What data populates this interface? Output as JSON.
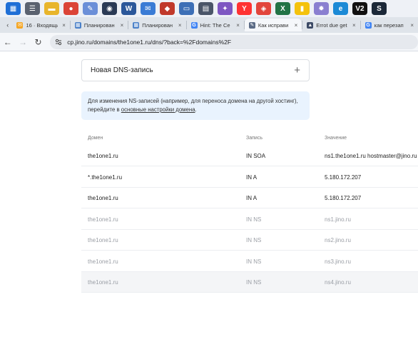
{
  "taskbar": {
    "icons": [
      {
        "name": "windows-widget-icon",
        "color": "#1f6fd6",
        "glyph": "▦"
      },
      {
        "name": "sliders-icon",
        "color": "#5a6270",
        "glyph": "☰"
      },
      {
        "name": "file-explorer-icon",
        "color": "#e8b52c",
        "glyph": "▬"
      },
      {
        "name": "chrome-icon",
        "color": "#db4437",
        "glyph": "●"
      },
      {
        "name": "paint-icon",
        "color": "#6b8fd8",
        "glyph": "✎"
      },
      {
        "name": "steam-like-icon",
        "color": "#2a3a55",
        "glyph": "◉"
      },
      {
        "name": "word-icon",
        "color": "#2b579a",
        "glyph": "W"
      },
      {
        "name": "mail-icon",
        "color": "#3a7bd5",
        "glyph": "✉"
      },
      {
        "name": "game-icon",
        "color": "#c0392b",
        "glyph": "◆"
      },
      {
        "name": "monitor-icon",
        "color": "#3d6fb6",
        "glyph": "▭"
      },
      {
        "name": "calculator-icon",
        "color": "#4a5568",
        "glyph": "▤"
      },
      {
        "name": "paint3d-icon",
        "color": "#7e57c2",
        "glyph": "✦"
      },
      {
        "name": "yandex-browser-icon",
        "color": "#ff3333",
        "glyph": "Y"
      },
      {
        "name": "anydesk-icon",
        "color": "#e2453c",
        "glyph": "◈"
      },
      {
        "name": "excel-icon",
        "color": "#217346",
        "glyph": "X"
      },
      {
        "name": "notepad-icon",
        "color": "#f4c20d",
        "glyph": "▮"
      },
      {
        "name": "settings-icon",
        "color": "#8a7fd0",
        "glyph": "✹"
      },
      {
        "name": "edge-icon",
        "color": "#1c8ad6",
        "glyph": "e"
      },
      {
        "name": "v2-icon",
        "color": "#111111",
        "glyph": "V2"
      },
      {
        "name": "steam-icon",
        "color": "#1b2838",
        "glyph": "S"
      }
    ]
  },
  "tabs": [
    {
      "label": "16 · Входящие",
      "fav_color": "#f5a623",
      "fav_glyph": "✉",
      "active": false
    },
    {
      "label": "Планирован",
      "fav_color": "#4a80c8",
      "fav_glyph": "▦",
      "active": false
    },
    {
      "label": "Планирован",
      "fav_color": "#4a80c8",
      "fav_glyph": "▦",
      "active": false
    },
    {
      "label": "Hint: The Ce",
      "fav_color": "#4285f4",
      "fav_glyph": "G",
      "active": false
    },
    {
      "label": "Как исправи",
      "fav_color": "#5b6b86",
      "fav_glyph": "✎",
      "active": true
    },
    {
      "label": "Errot due get",
      "fav_color": "#3c4a66",
      "fav_glyph": "▲",
      "active": false
    },
    {
      "label": "как перезап",
      "fav_color": "#4285f4",
      "fav_glyph": "G",
      "active": false
    }
  ],
  "address": {
    "url": "cp.jino.ru/domains/the1one1.ru/dns/?back=%2Fdomains%2F"
  },
  "page": {
    "new_record_title": "Новая DNS-запись",
    "new_record_plus": "+",
    "info_text": "Для изменения NS-записей (например, для переноса домена на другой хостинг), перейдите в ",
    "info_link": "основные настройки домена",
    "info_end": ".",
    "columns": {
      "domain": "Домен",
      "record": "Запись",
      "value": "Значение"
    },
    "rows": [
      {
        "domain": "the1one1.ru",
        "record": "IN SOA",
        "value": "ns1.the1one1.ru hostmaster@jino.ru",
        "style": "dark"
      },
      {
        "domain": "*.the1one1.ru",
        "record": "IN A",
        "value": "5.180.172.207",
        "style": "dark"
      },
      {
        "domain": "the1one1.ru",
        "record": "IN A",
        "value": "5.180.172.207",
        "style": "dark"
      },
      {
        "domain": "the1one1.ru",
        "record": "IN NS",
        "value": "ns1.jino.ru",
        "style": "muted"
      },
      {
        "domain": "the1one1.ru",
        "record": "IN NS",
        "value": "ns2.jino.ru",
        "style": "muted"
      },
      {
        "domain": "the1one1.ru",
        "record": "IN NS",
        "value": "ns3.jino.ru",
        "style": "muted"
      },
      {
        "domain": "the1one1.ru",
        "record": "IN NS",
        "value": "ns4.jino.ru",
        "style": "muted shade"
      }
    ]
  }
}
